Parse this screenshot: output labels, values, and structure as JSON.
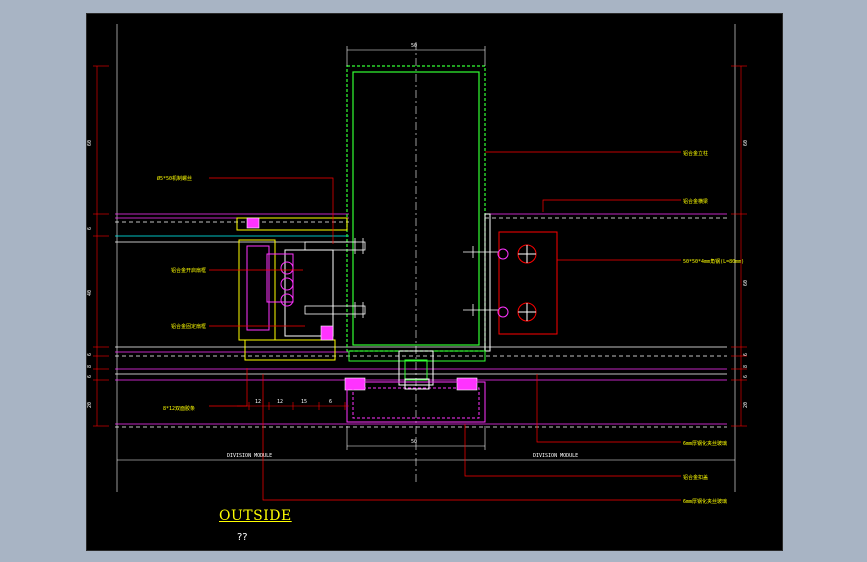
{
  "drawing": {
    "title": "OUTSIDE",
    "subtitle": "??",
    "dimensions": {
      "top_width": "50",
      "bottom_width": "50",
      "left_upper": "60",
      "left_mid_small": "6",
      "left_mid": "40",
      "left_bottom_a": "6",
      "left_bottom_b": "8",
      "left_bottom_c": "6",
      "left_bottom_d": "20",
      "right_upper": "60",
      "right_mid": "60",
      "right_bottom_a": "6",
      "right_bottom_b": "8",
      "right_bottom_c": "6",
      "right_bottom_d": "20",
      "bottom_seg_1": "12",
      "bottom_seg_2": "12",
      "bottom_seg_3": "15",
      "bottom_seg_4": "6"
    },
    "labels": {
      "steel_angle": "Ø5*50机制螺丝",
      "open_leaf_frame": "铝合金开启扇框",
      "fixed_frame": "铝合金固定扇框",
      "gasket": "8*12双面胶条",
      "mullion": "铝合金立柱",
      "transom": "铝合金横梁",
      "steel_bracket": "50*50*4mm角钢(L=80mm)",
      "glass_left": "6mm厚钢化夹丝玻璃",
      "cover_cap": "铝合金扣盖",
      "glass_right": "6mm厚钢化夹丝玻璃",
      "division_left": "DIVISION MODULE",
      "division_right": "DIVISION MODULE"
    },
    "colors": {
      "viewport_bg": "#000000",
      "frame": "#a8b4c4",
      "leader": "#ff0000",
      "profile_green": "#33ff33",
      "profile_magenta": "#ff33ff",
      "text": "#ffff00",
      "dim_line": "#ffffff"
    }
  }
}
